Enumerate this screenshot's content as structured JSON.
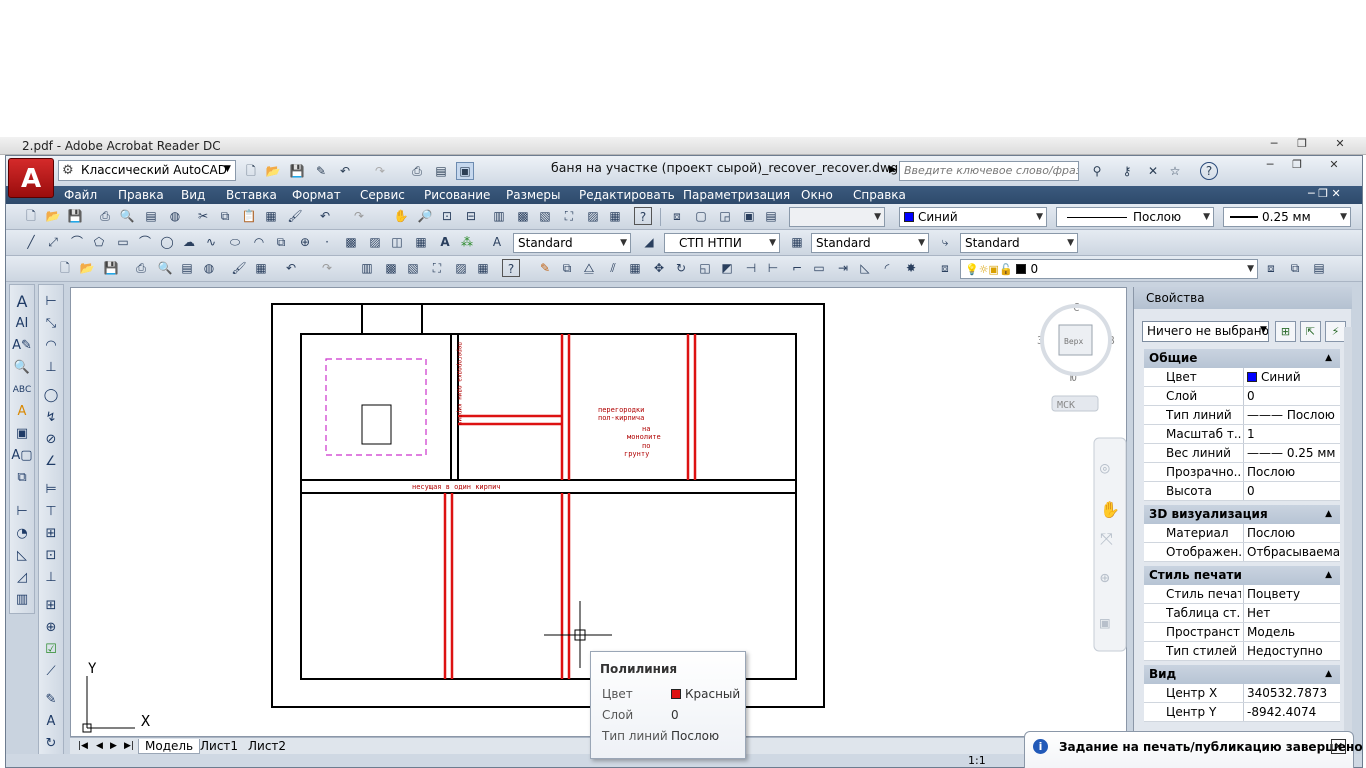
{
  "acrobat": {
    "title": "2.pdf - Adobe Acrobat Reader DC",
    "min": "─",
    "max": "❐",
    "close": "✕"
  },
  "titlebar": {
    "app_logo": "A",
    "workspace": "Классический AutoCAD",
    "doc_title": "баня на участке (проект сырой)_recover_recover.dwg",
    "search_placeholder": "Введите ключевое слово/фразу",
    "min": "─",
    "max": "❐",
    "close": "✕"
  },
  "menubar": {
    "items": [
      "Файл",
      "Правка",
      "Вид",
      "Вставка",
      "Формат",
      "Сервис",
      "Рисование",
      "Размеры",
      "Редактировать",
      "Параметризация",
      "Окно",
      "Справка"
    ]
  },
  "toolbar1": {
    "color": "Синий",
    "linetype": "Послою",
    "lineweight": "0.25 мм"
  },
  "toolbar2": {
    "text_style": "Standard",
    "dim_style": "СТП НТПИ",
    "table_style": "Standard",
    "mleader_style": "Standard"
  },
  "toolbar3": {
    "layer": "0"
  },
  "viewcube": {
    "n": "С",
    "s": "Ю",
    "w": "З",
    "e": "В",
    "top": "Верх",
    "ucs": "МСК"
  },
  "drawing": {
    "note_partitions": [
      "перегородки",
      "пол-кирпича",
      "на",
      "монолите",
      "по",
      "грунту"
    ],
    "note_bearing": "несущая в один кирпич",
    "note_vertical": "перегородка один кирпич",
    "axis_x": "X",
    "axis_y": "Y"
  },
  "layout_tabs": {
    "nav": [
      "|◀",
      "◀",
      "▶",
      "▶|"
    ],
    "tabs": [
      "Модель",
      "Лист1",
      "Лист2"
    ]
  },
  "properties": {
    "title": "Свойства",
    "selection": "Ничего не выбрано",
    "sections": [
      {
        "name": "Общие",
        "rows": [
          {
            "k": "Цвет",
            "v": "Синий"
          },
          {
            "k": "Слой",
            "v": "0"
          },
          {
            "k": "Тип линий",
            "v": "——— Послою"
          },
          {
            "k": "Масштаб т...",
            "v": "1"
          },
          {
            "k": "Вес линий",
            "v": "——— 0.25 мм"
          },
          {
            "k": "Прозрачно...",
            "v": "Послою"
          },
          {
            "k": "Высота",
            "v": "0"
          }
        ]
      },
      {
        "name": "3D визуализация",
        "rows": [
          {
            "k": "Материал",
            "v": "Послою"
          },
          {
            "k": "Отображен...",
            "v": "Отбрасываема..."
          }
        ]
      },
      {
        "name": "Стиль печати",
        "rows": [
          {
            "k": "Стиль печати",
            "v": "Поцвету"
          },
          {
            "k": "Таблица ст...",
            "v": "Нет"
          },
          {
            "k": "Пространст...",
            "v": "Модель"
          },
          {
            "k": "Тип стилей ...",
            "v": "Недоступно"
          }
        ]
      },
      {
        "name": "Вид",
        "rows": [
          {
            "k": "Центр X",
            "v": "340532.7873"
          },
          {
            "k": "Центр Y",
            "v": "-8942.4074"
          }
        ]
      }
    ]
  },
  "tooltip": {
    "title": "Полилиния",
    "color_label": "Цвет",
    "color_value": "Красный",
    "layer_label": "Слой",
    "layer_value": "0",
    "linetype_label": "Тип линий",
    "linetype_value": "Послою"
  },
  "notification": {
    "icon": "i",
    "text": "Задание на печать/публикацию завершено",
    "close": "✕"
  },
  "status": {
    "scale": "1:1"
  },
  "colors": {
    "blue": "#0000ff",
    "red": "#dd1111",
    "wall": "#000000",
    "dashed": "#cc33cc"
  }
}
